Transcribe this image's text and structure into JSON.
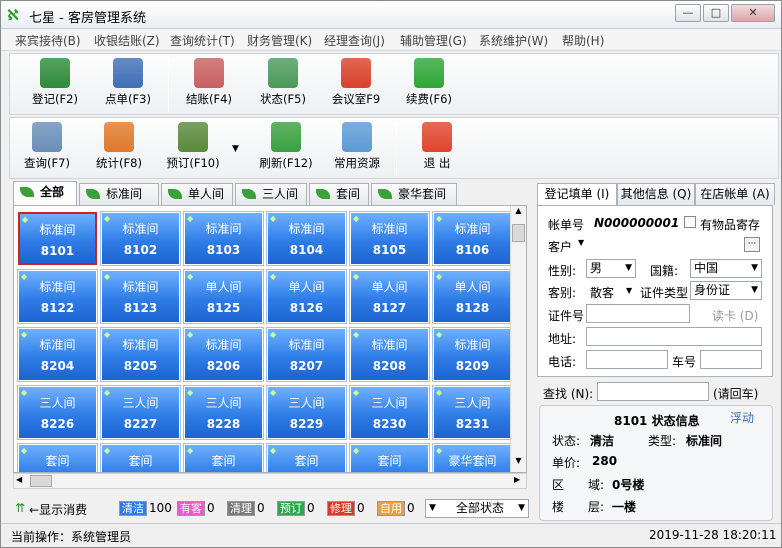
{
  "window": {
    "title": "七星 - 客房管理系统",
    "app_icon": "qx",
    "min": "—",
    "max": "□",
    "close": "✕"
  },
  "menu": [
    "来宾接待(B)",
    "收银结账(Z)",
    "查询统计(T)",
    "财务管理(K)",
    "经理查询(J)",
    "辅助管理(G)",
    "系统维护(W)",
    "帮助(H)"
  ],
  "toolbar1": [
    {
      "label": "登记(F2)",
      "icon": "pencil-register-icon",
      "color": "#2e8b3a"
    },
    {
      "label": "点单(F3)",
      "icon": "users-order-icon",
      "color": "#3f6fb7"
    },
    {
      "label": "结账(F4)",
      "icon": "invoice-checkout-icon",
      "color": "#c86060"
    },
    {
      "label": "状态(F5)",
      "icon": "cubes-status-icon",
      "color": "#4a9a5a"
    },
    {
      "label": "会议室F9",
      "icon": "house-meeting-icon",
      "color": "#d9432b"
    },
    {
      "label": "续费(F6)",
      "icon": "dollar-renew-icon",
      "color": "#2fa636"
    }
  ],
  "toolbar2": [
    {
      "label": "查询(F7)",
      "icon": "magnifier-search-icon",
      "color": "#6a8fb8"
    },
    {
      "label": "统计(F8)",
      "icon": "blocks-stats-icon",
      "color": "#e0792a"
    },
    {
      "label": "预订(F10)",
      "icon": "clapper-booking-icon",
      "color": "#5a8a3a"
    },
    {
      "label": "刷新(F12)",
      "icon": "recycle-refresh-icon",
      "color": "#3aa040"
    },
    {
      "label": "常用资源",
      "icon": "scroll-resources-icon",
      "color": "#5c9bd6"
    },
    {
      "label": "退  出",
      "icon": "power-exit-icon",
      "color": "#e0452a"
    }
  ],
  "room_tabs": [
    "全部",
    "标准间",
    "单人间",
    "三人间",
    "套间",
    "豪华套间"
  ],
  "rooms": [
    [
      {
        "type": "标准间",
        "no": "8101"
      },
      {
        "type": "标准间",
        "no": "8102"
      },
      {
        "type": "标准间",
        "no": "8103"
      },
      {
        "type": "标准间",
        "no": "8104"
      },
      {
        "type": "标准间",
        "no": "8105"
      },
      {
        "type": "标准间",
        "no": "8106"
      }
    ],
    [
      {
        "type": "标准间",
        "no": "8122"
      },
      {
        "type": "标准间",
        "no": "8123"
      },
      {
        "type": "单人间",
        "no": "8125"
      },
      {
        "type": "单人间",
        "no": "8126"
      },
      {
        "type": "单人间",
        "no": "8127"
      },
      {
        "type": "单人间",
        "no": "8128"
      }
    ],
    [
      {
        "type": "标准间",
        "no": "8204"
      },
      {
        "type": "标准间",
        "no": "8205"
      },
      {
        "type": "标准间",
        "no": "8206"
      },
      {
        "type": "标准间",
        "no": "8207"
      },
      {
        "type": "标准间",
        "no": "8208"
      },
      {
        "type": "标准间",
        "no": "8209"
      }
    ],
    [
      {
        "type": "三人间",
        "no": "8226"
      },
      {
        "type": "三人间",
        "no": "8227"
      },
      {
        "type": "三人间",
        "no": "8228"
      },
      {
        "type": "三人间",
        "no": "8229"
      },
      {
        "type": "三人间",
        "no": "8230"
      },
      {
        "type": "三人间",
        "no": "8231"
      }
    ],
    [
      {
        "type": "套间",
        "no": ""
      },
      {
        "type": "套间",
        "no": ""
      },
      {
        "type": "套间",
        "no": ""
      },
      {
        "type": "套间",
        "no": ""
      },
      {
        "type": "套间",
        "no": ""
      },
      {
        "type": "豪华套间",
        "no": ""
      }
    ]
  ],
  "status_row": {
    "toggle": "显示消费",
    "chips": [
      {
        "label": "清洁",
        "count": "100",
        "bg": "#2f7de8",
        "fg": "#ffffff"
      },
      {
        "label": "有客",
        "count": "0",
        "bg": "#e85ad0",
        "fg": "#ffffff"
      },
      {
        "label": "清理",
        "count": "0",
        "bg": "#7a7a7a",
        "fg": "#ffffff"
      },
      {
        "label": "预订",
        "count": "0",
        "bg": "#2aa84a",
        "fg": "#ffffff"
      },
      {
        "label": "修理",
        "count": "0",
        "bg": "#d83a2a",
        "fg": "#ffffff"
      },
      {
        "label": "自用",
        "count": "0",
        "bg": "#e8a040",
        "fg": "#ffffff"
      }
    ],
    "filter": "全部状态"
  },
  "right_tabs": [
    "登记填单 (I)",
    "其他信息 (Q)",
    "在店帐单 (A)"
  ],
  "form": {
    "bill_label": "帐单号",
    "bill_no": "N000000001",
    "deposit_label": "有物品寄存",
    "guest_label": "客户",
    "gender_label": "性别:",
    "gender": "男",
    "nation_label": "国籍:",
    "nation": "中国",
    "guest_type_label": "客别:",
    "guest_type": "散客",
    "id_type_label": "证件类型",
    "id_type": "身份证",
    "id_no_label": "证件号",
    "read_card": "读卡 (D)",
    "address_label": "地址:",
    "phone_label": "电话:",
    "plate_label": "车号"
  },
  "find": {
    "label": "查找 (N):",
    "back": "(请回车)"
  },
  "room_info": {
    "title": "8101 状态信息",
    "float": "浮动",
    "status_label": "状态:",
    "status": "清洁",
    "type_label": "类型:",
    "type": "标准间",
    "price_label": "单价:",
    "price": "280",
    "zone_label": "区",
    "zone_label2": "域:",
    "zone": "0号楼",
    "floor_label": "楼",
    "floor_label2": "层:",
    "floor": "一楼"
  },
  "statusbar": {
    "operation": "当前操作：系统管理员",
    "time": "2019-11-28 18:20:11"
  }
}
